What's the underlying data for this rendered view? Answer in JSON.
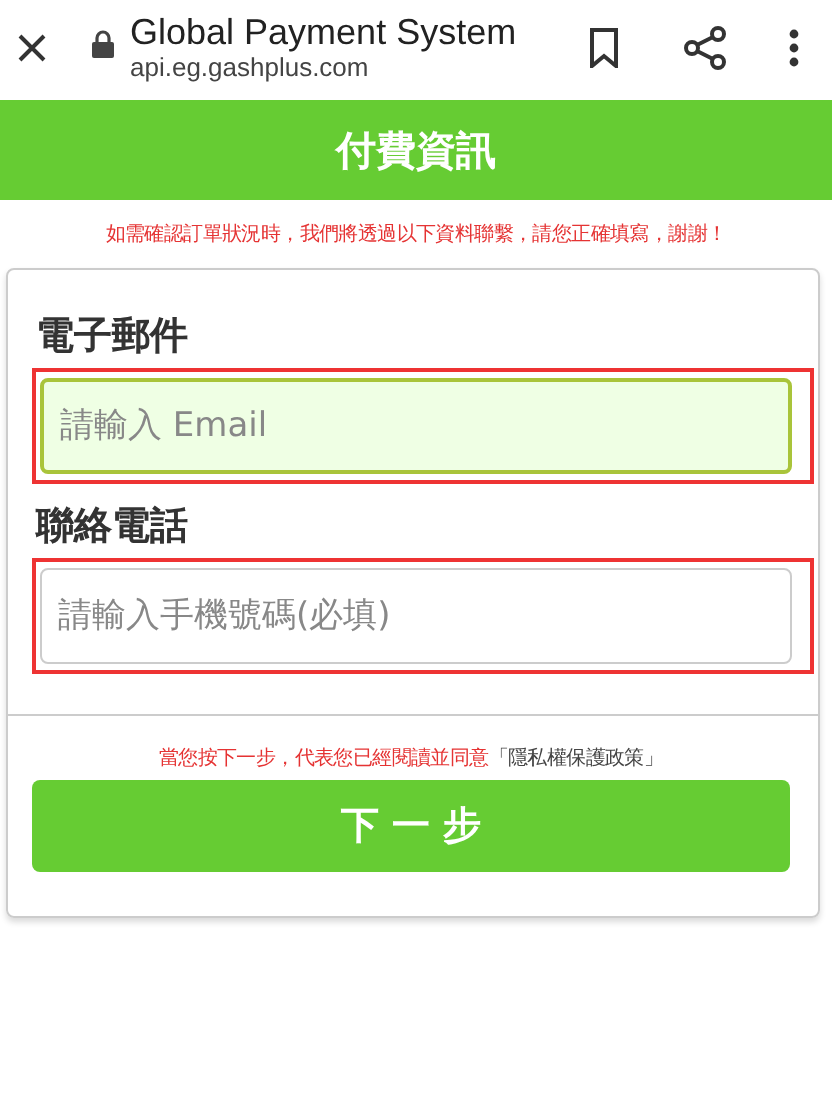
{
  "browser": {
    "title": "Global Payment System",
    "url": "api.eg.gashplus.com"
  },
  "header": {
    "title": "付費資訊"
  },
  "notice": "如需確認訂單狀況時，我們將透過以下資料聯繫，請您正確填寫，謝謝！",
  "fields": [
    {
      "label": "電子郵件",
      "placeholder": "請輸入 Email",
      "focused": true,
      "highlighted": true
    },
    {
      "label": "聯絡電話",
      "placeholder": "請輸入手機號碼(必填)",
      "focused": false,
      "highlighted": true
    }
  ],
  "consent": {
    "text": "當您按下一步，代表您已經閱讀並同意",
    "link": "「隱私權保護政策」"
  },
  "button": "下 一 步"
}
